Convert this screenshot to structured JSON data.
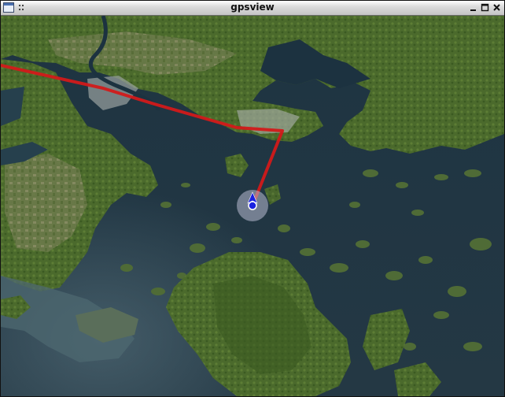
{
  "window": {
    "title": "gpsview",
    "controls": [
      "minimize",
      "maximize",
      "close"
    ]
  },
  "map": {
    "type": "satellite-imagery",
    "track_color": "#d21a1a",
    "marker": {
      "icon": "navigation-arrow",
      "dot_color": "#1b22e0",
      "halo_color": "#b9bcd2"
    }
  }
}
